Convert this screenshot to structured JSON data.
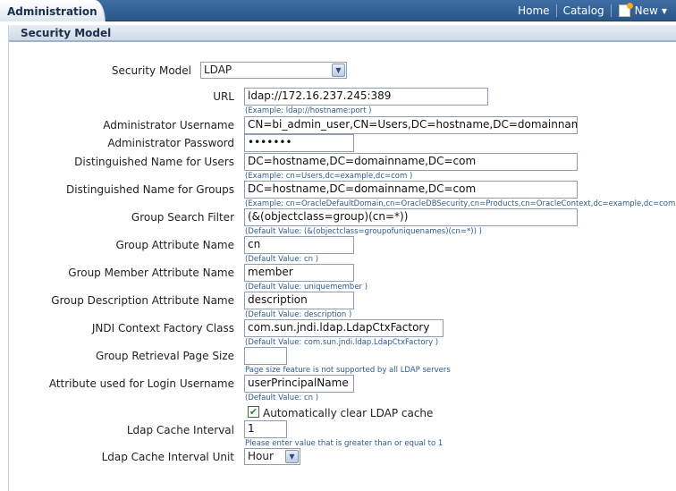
{
  "topbar": {
    "tab_label": "Administration",
    "home": "Home",
    "catalog": "Catalog",
    "new": "New"
  },
  "section": {
    "title": "Security Model"
  },
  "form": {
    "security_model": {
      "label": "Security Model",
      "value": "LDAP"
    },
    "url": {
      "label": "URL",
      "value": "ldap://172.16.237.245:389",
      "hint": "(Example: ldap://hostname:port )"
    },
    "admin_username": {
      "label": "Administrator Username",
      "value": "CN=bi_admin_user,CN=Users,DC=hostname,DC=domainname,DC=c"
    },
    "admin_password": {
      "label": "Administrator Password",
      "value": "•••••••"
    },
    "dn_users": {
      "label": "Distinguished Name for Users",
      "value": "DC=hostname,DC=domainname,DC=com",
      "hint": "(Example: cn=Users,dc=example,dc=com )"
    },
    "dn_groups": {
      "label": "Distinguished Name for Groups",
      "value": "DC=hostname,DC=domainname,DC=com",
      "hint": "(Example: cn=OracleDefaultDomain,cn=OracleDBSecurity,cn=Products,cn=OracleContext,dc=example,dc=com )"
    },
    "group_filter": {
      "label": "Group Search Filter",
      "value": "(&(objectclass=group)(cn=*))",
      "hint": "(Default Value: (&(objectclass=groupofuniquenames)(cn=*)) )"
    },
    "group_attr": {
      "label": "Group Attribute Name",
      "value": "cn",
      "hint": "(Default Value: cn )"
    },
    "group_member_attr": {
      "label": "Group Member Attribute Name",
      "value": "member",
      "hint": "(Default Value: uniquemember )"
    },
    "group_desc_attr": {
      "label": "Group Description Attribute Name",
      "value": "description",
      "hint": "(Default Value: description )"
    },
    "jndi_factory": {
      "label": "JNDI Context Factory Class",
      "value": "com.sun.jndi.ldap.LdapCtxFactory",
      "hint": "(Default Value: com.sun.jndi.ldap.LdapCtxFactory )"
    },
    "page_size": {
      "label": "Group Retrieval Page Size",
      "value": "",
      "hint": "Page size feature is not supported by all LDAP servers"
    },
    "login_attr": {
      "label": "Attribute used for Login Username",
      "value": "userPrincipalName",
      "hint": "(Default Value: cn )"
    },
    "auto_clear": {
      "label": "Automatically clear LDAP cache",
      "checked": true
    },
    "cache_interval": {
      "label": "Ldap Cache Interval",
      "value": "1",
      "hint": "Please enter value that is greater than or equal to 1"
    },
    "cache_unit": {
      "label": "Ldap Cache Interval Unit",
      "value": "Hour"
    }
  }
}
